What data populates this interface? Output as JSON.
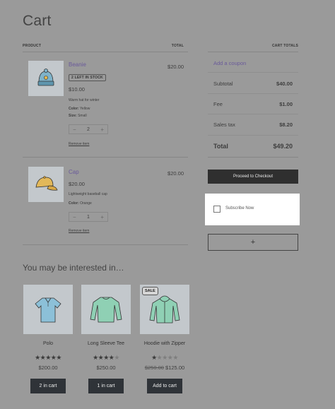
{
  "page": {
    "title": "Cart"
  },
  "cart_table": {
    "col_product": "PRODUCT",
    "col_total": "TOTAL",
    "items": [
      {
        "name": "Beanie",
        "stock_badge": "2 LEFT IN STOCK",
        "price": "$10.00",
        "description": "Warm hat for winter",
        "meta": [
          {
            "key": "Color:",
            "value": "Yellow"
          },
          {
            "key": "Size:",
            "value": "Small"
          }
        ],
        "quantity": "2",
        "line_total": "$20.00",
        "remove_label": "Remove item"
      },
      {
        "name": "Cap",
        "price": "$20.00",
        "description": "Lightweight baseball cap",
        "meta": [
          {
            "key": "Color:",
            "value": "Orange"
          }
        ],
        "quantity": "1",
        "line_total": "$20.00",
        "remove_label": "Remove item"
      }
    ]
  },
  "totals": {
    "heading": "CART TOTALS",
    "coupon_link": "Add a coupon",
    "rows": [
      {
        "label": "Subtotal",
        "value": "$40.00"
      },
      {
        "label": "Fee",
        "value": "$1.00"
      },
      {
        "label": "Sales tax",
        "value": "$8.20"
      }
    ],
    "total_label": "Total",
    "total_value": "$49.20",
    "checkout_label": "Proceed to Checkout",
    "subscribe_label": "Subscribe Now",
    "plus_label": "+"
  },
  "related": {
    "title": "You may be interested in…",
    "products": [
      {
        "name": "Polo",
        "rating": 4.5,
        "price": "$200.00",
        "button": "2 in cart"
      },
      {
        "name": "Long Sleeve Tee",
        "rating": 4,
        "price": "$250.00",
        "button": "1 in cart"
      },
      {
        "name": "Hoodie with Zipper",
        "rating": 1.5,
        "sale_badge": "SALE",
        "old_price": "$250.00",
        "price": "$125.00",
        "button": "Add to cart"
      }
    ]
  },
  "colors": {
    "link": "#6a5a9a",
    "button_dark": "#2f3338",
    "thumb_bg": "#c3c8cc",
    "page_bg": "#9a9a9a"
  }
}
